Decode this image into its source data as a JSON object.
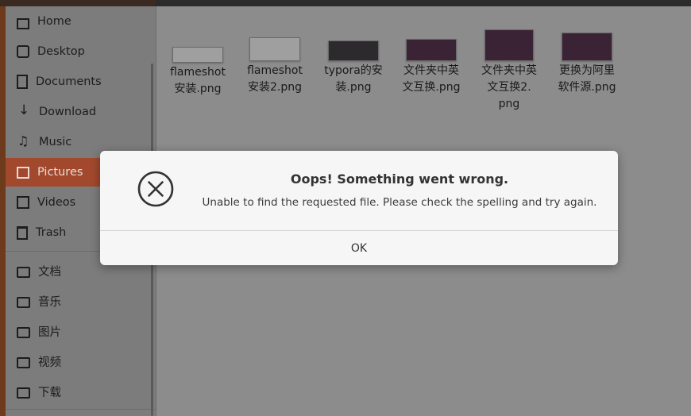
{
  "sidebar": {
    "items": [
      {
        "label": "Home",
        "icon": "home-icon"
      },
      {
        "label": "Desktop",
        "icon": "desktop-icon"
      },
      {
        "label": "Documents",
        "icon": "documents-icon"
      },
      {
        "label": "Download",
        "icon": "download-icon"
      },
      {
        "label": "Music",
        "icon": "music-icon"
      },
      {
        "label": "Pictures",
        "icon": "pictures-icon",
        "active": true
      },
      {
        "label": "Videos",
        "icon": "videos-icon"
      },
      {
        "label": "Trash",
        "icon": "trash-icon"
      }
    ],
    "bookmarks": [
      {
        "label": "文档",
        "icon": "folder-icon"
      },
      {
        "label": "音乐",
        "icon": "folder-icon"
      },
      {
        "label": "图片",
        "icon": "folder-icon"
      },
      {
        "label": "视频",
        "icon": "folder-icon"
      },
      {
        "label": "下载",
        "icon": "folder-icon"
      }
    ]
  },
  "files": [
    {
      "line1": "flameshot",
      "line2": "安装.png"
    },
    {
      "line1": "flameshot",
      "line2": "安装2.png"
    },
    {
      "line1": "typora的安",
      "line2": "装.png"
    },
    {
      "line1": "文件夹中英",
      "line2": "文互换.png"
    },
    {
      "line1": "文件夹中英",
      "line2": "文互换2.",
      "line3": "png"
    },
    {
      "line1": "更换为阿里",
      "line2": "软件源.png"
    }
  ],
  "dialog": {
    "title": "Oops! Something went wrong.",
    "message": "Unable to find the requested file. Please check the spelling and try again.",
    "ok_label": "OK",
    "icon": "error-circle-x-icon"
  },
  "colors": {
    "accent": "#a2492d",
    "dialog_bg": "#f6f6f6"
  }
}
